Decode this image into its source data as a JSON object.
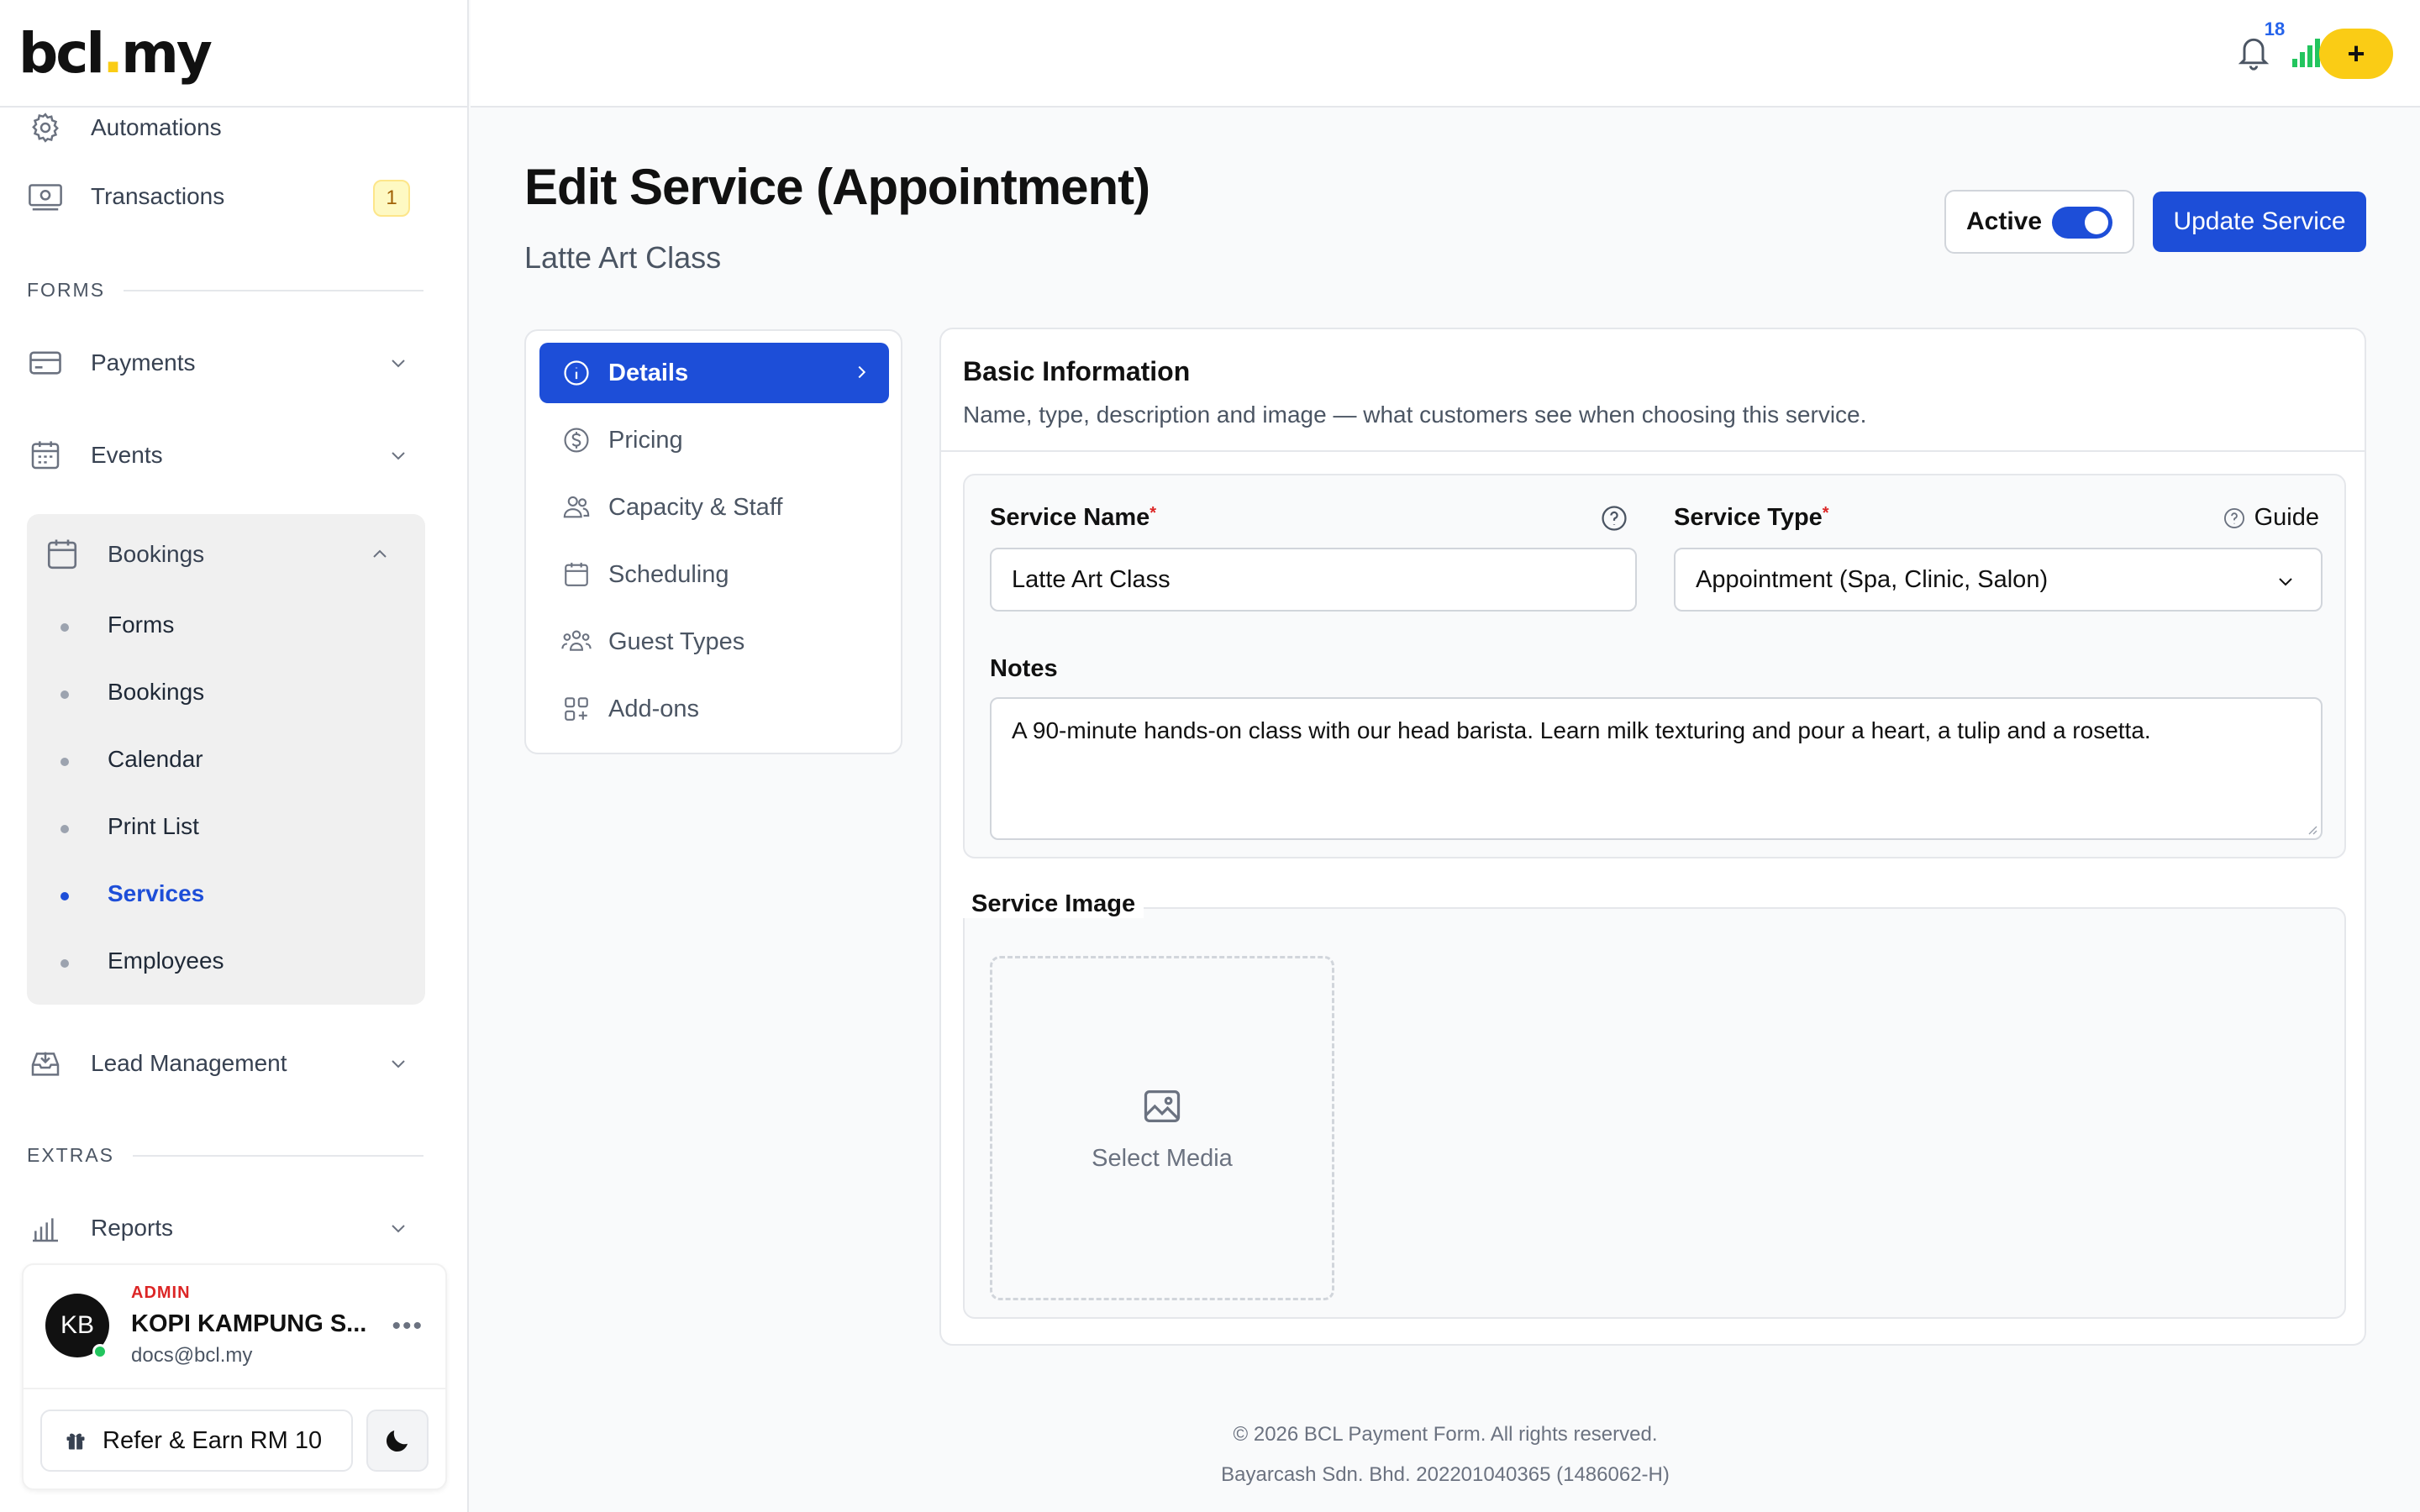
{
  "brand": {
    "logo_left": "bcl",
    "logo_dot": ".",
    "logo_right": "my",
    "accent": "#facc15",
    "primary": "#1d4ed8"
  },
  "sidebar": {
    "items_top": [
      {
        "label": "Automations",
        "icon": "gear-icon"
      },
      {
        "label": "Transactions",
        "icon": "cash-icon",
        "badge": "1"
      }
    ],
    "section_forms": "FORMS",
    "payments": "Payments",
    "events": "Events",
    "bookings": {
      "label": "Bookings",
      "items": [
        "Forms",
        "Bookings",
        "Calendar",
        "Print List",
        "Services",
        "Employees"
      ],
      "active": "Services"
    },
    "lead_management": "Lead Management",
    "section_extras": "EXTRAS",
    "reports": "Reports"
  },
  "user": {
    "initials": "KB",
    "role": "ADMIN",
    "name": "KOPI KAMPUNG S...",
    "email": "docs@bcl.my",
    "more": "•••",
    "refer_label": "Refer & Earn RM 10"
  },
  "topbar": {
    "notification_count": "18",
    "add": "+"
  },
  "page": {
    "title": "Edit Service (Appointment)",
    "subtitle": "Latte Art Class",
    "active_label": "Active",
    "update_button": "Update Service"
  },
  "tabs": [
    {
      "label": "Details",
      "icon": "info-icon"
    },
    {
      "label": "Pricing",
      "icon": "dollar-icon"
    },
    {
      "label": "Capacity & Staff",
      "icon": "users-icon"
    },
    {
      "label": "Scheduling",
      "icon": "calendar-icon"
    },
    {
      "label": "Guest Types",
      "icon": "group-icon"
    },
    {
      "label": "Add-ons",
      "icon": "add-grid-icon"
    }
  ],
  "form": {
    "section_title": "Basic Information",
    "section_desc": "Name, type, description and image — what customers see when choosing this service.",
    "service_name_label": "Service Name",
    "service_name_value": "Latte Art Class",
    "service_type_label": "Service Type",
    "guide_label": "Guide",
    "service_type_value": "Appointment (Spa, Clinic, Salon)",
    "notes_label": "Notes",
    "notes_value": "A 90-minute hands-on class with our head barista. Learn milk texturing and pour a heart, a tulip and a rosetta.",
    "image_label": "Service Image",
    "select_media": "Select Media",
    "required_mark": "*"
  },
  "footer": {
    "copyright": "© 2026 BCL Payment Form. All rights reserved.",
    "company": "Bayarcash Sdn. Bhd. 202201040365 (1486062-H)"
  }
}
